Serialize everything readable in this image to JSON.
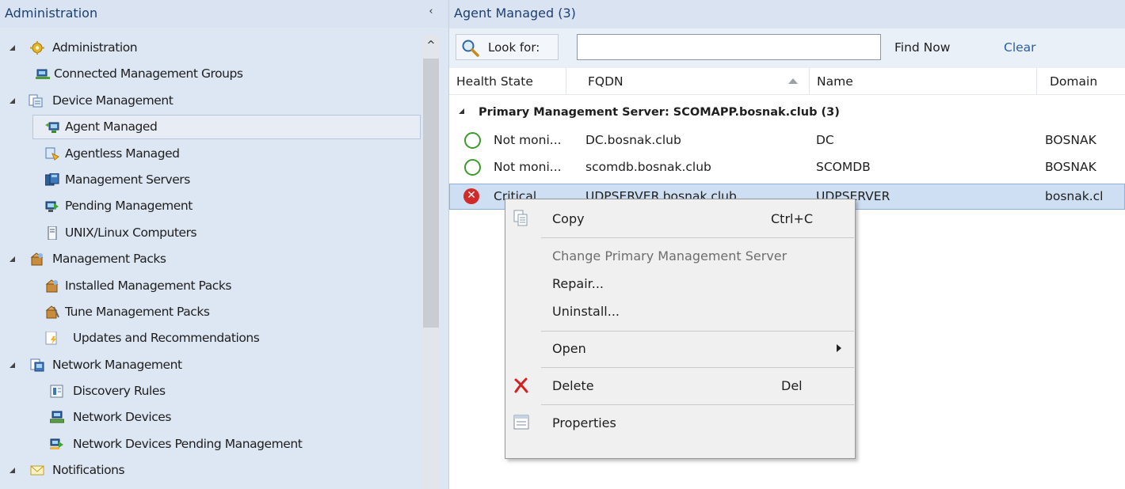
{
  "left": {
    "title": "Administration",
    "collapse_glyph": "‹",
    "scroll_up_glyph": "^",
    "tree": [
      {
        "label": "Administration",
        "level": 0,
        "icon": "gear-icon"
      },
      {
        "label": "Connected Management Groups",
        "level": 1,
        "icon": "connected-groups-icon"
      },
      {
        "label": "Device Management",
        "level": 0,
        "icon": "device-management-icon"
      },
      {
        "label": "Agent Managed",
        "level": 1,
        "icon": "agent-managed-icon"
      },
      {
        "label": "Agentless Managed",
        "level": 1,
        "icon": "agentless-managed-icon"
      },
      {
        "label": "Management Servers",
        "level": 1,
        "icon": "management-servers-icon"
      },
      {
        "label": "Pending Management",
        "level": 1,
        "icon": "pending-management-icon"
      },
      {
        "label": "UNIX/Linux Computers",
        "level": 1,
        "icon": "unix-computer-icon"
      },
      {
        "label": "Management Packs",
        "level": 0,
        "icon": "management-packs-icon"
      },
      {
        "label": "Installed Management Packs",
        "level": 1,
        "icon": "installed-packs-icon"
      },
      {
        "label": "Tune Management Packs",
        "level": 1,
        "icon": "tune-packs-icon"
      },
      {
        "label": "Updates and Recommendations",
        "level": 1,
        "icon": "updates-icon"
      },
      {
        "label": "Network Management",
        "level": 0,
        "icon": "network-management-icon"
      },
      {
        "label": "Discovery Rules",
        "level": 1,
        "icon": "discovery-rules-icon"
      },
      {
        "label": "Network Devices",
        "level": 1,
        "icon": "network-devices-icon"
      },
      {
        "label": "Network Devices Pending Management",
        "level": 1,
        "icon": "network-pending-icon"
      },
      {
        "label": "Notifications",
        "level": 0,
        "icon": "envelope-icon"
      }
    ]
  },
  "right": {
    "title": "Agent Managed (3)",
    "lookfor_label": "Look for:",
    "search_value": "",
    "find_now": "Find Now",
    "clear": "Clear",
    "columns": [
      "Health State",
      "FQDN",
      "Name",
      "Domain"
    ],
    "group_label": "Primary Management Server: SCOMAPP.bosnak.club (3)",
    "rows": [
      {
        "health": "Not moni...",
        "status": "ok",
        "fqdn": "DC.bosnak.club",
        "name": "DC",
        "domain": "BOSNAK"
      },
      {
        "health": "Not moni...",
        "status": "ok",
        "fqdn": "scomdb.bosnak.club",
        "name": "SCOMDB",
        "domain": "BOSNAK"
      },
      {
        "health": "Critical",
        "status": "critical",
        "fqdn": "UDPSERVER.bosnak.club",
        "name": "UDPSERVER",
        "domain": "bosnak.cl"
      }
    ]
  },
  "context_menu": {
    "copy": "Copy",
    "copy_shortcut": "Ctrl+C",
    "change_server": "Change Primary Management Server",
    "repair": "Repair...",
    "uninstall": "Uninstall...",
    "open": "Open",
    "delete": "Delete",
    "delete_shortcut": "Del",
    "properties": "Properties"
  },
  "colors": {
    "pane_bg": "#dde6f3",
    "header_text": "#1f3f6e",
    "selection": "#cfdff3",
    "critical": "#d22a2a",
    "ok": "#3b9a2a",
    "link": "#2b5da6"
  }
}
